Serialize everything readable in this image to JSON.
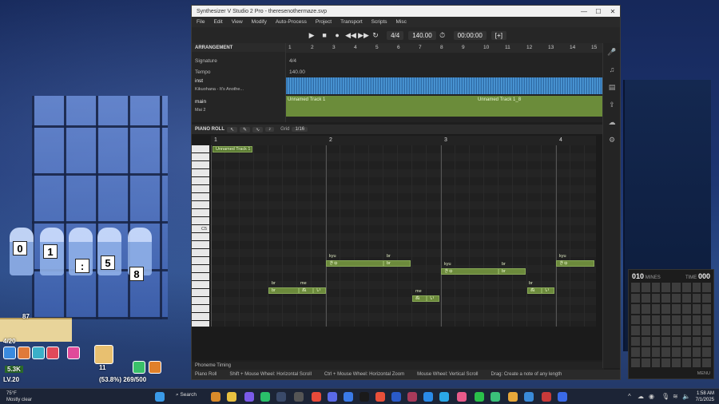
{
  "window": {
    "title": "Synthesizer V Studio 2 Pro - theresenothermaze.svp",
    "controls": [
      "—",
      "☐",
      "✕"
    ]
  },
  "menu": [
    "File",
    "Edit",
    "View",
    "Modify",
    "Auto-Process",
    "Project",
    "Transport",
    "Scripts",
    "Misc"
  ],
  "transport": {
    "time_signature": "4/4",
    "tempo": "140.00",
    "time": "00:00:00",
    "time_suffix": "[+]"
  },
  "arrangement": {
    "title": "ARRANGEMENT",
    "signature_label": "Signature",
    "tempo_label": "Tempo",
    "signature_value": "4/4",
    "tempo_value": "140.00",
    "measures": [
      "1",
      "2",
      "3",
      "4",
      "5",
      "6",
      "7",
      "8",
      "9",
      "10",
      "11",
      "12",
      "13",
      "14",
      "15"
    ],
    "tracks": [
      {
        "name": "inst",
        "sub": "Kikuohana - It's Anothe..."
      },
      {
        "name": "main",
        "sub": "Mai 2"
      }
    ],
    "main_groups": [
      "Unnamed Track 1",
      "Unnamed Track 1_8"
    ]
  },
  "piano_roll": {
    "title": "PIANO ROLL",
    "grid_label": "Grid",
    "grid_value": "1/16",
    "measures": [
      "1",
      "2",
      "3",
      "4"
    ],
    "group_label": "Unnamed Track 1",
    "c_label": "C5",
    "notes": [
      {
        "lyric": "br",
        "text": "br"
      },
      {
        "lyric": "me",
        "text": "ぬ"
      },
      {
        "lyric": "",
        "text": "い"
      },
      {
        "lyric": "kyu",
        "text": "きゅ"
      },
      {
        "lyric": "br",
        "text": "br"
      },
      {
        "lyric": "me",
        "text": "ぬ"
      },
      {
        "lyric": "",
        "text": "い"
      },
      {
        "lyric": "kyu",
        "text": "きゅ"
      },
      {
        "lyric": "br",
        "text": "br"
      },
      {
        "lyric": "br",
        "text": "br"
      },
      {
        "lyric": "me",
        "text": "ぬ"
      },
      {
        "lyric": "",
        "text": "い"
      },
      {
        "lyric": "kyu",
        "text": "きゅ"
      }
    ]
  },
  "phoneme_timing": "Phoneme Timing",
  "status": {
    "panel": "Piano Roll",
    "hints": [
      "Shift + Mouse Wheel: Horizontal Scroll",
      "Ctrl + Mouse Wheel: Horizontal Zoom",
      "Mouse Wheel: Vertical Scroll",
      "Drag: Create a note of any length"
    ]
  },
  "game": {
    "scores": [
      "0",
      "1",
      ":",
      "5",
      "8"
    ],
    "progress_text": "4/20",
    "level_text": "LV.20",
    "exp_text": "(53.8%) 269/500",
    "coins": "5.3K",
    "item_count": "11",
    "stars": "87"
  },
  "minesweeper": {
    "mines_count": "010",
    "mines_label": "MINES",
    "time_label": "TIME",
    "time_value": "000",
    "menu": "MENU"
  },
  "taskbar": {
    "temp": "75°F",
    "weather": "Mostly clear",
    "search": "Search",
    "time": "1:58 AM",
    "date": "7/1/2025"
  }
}
